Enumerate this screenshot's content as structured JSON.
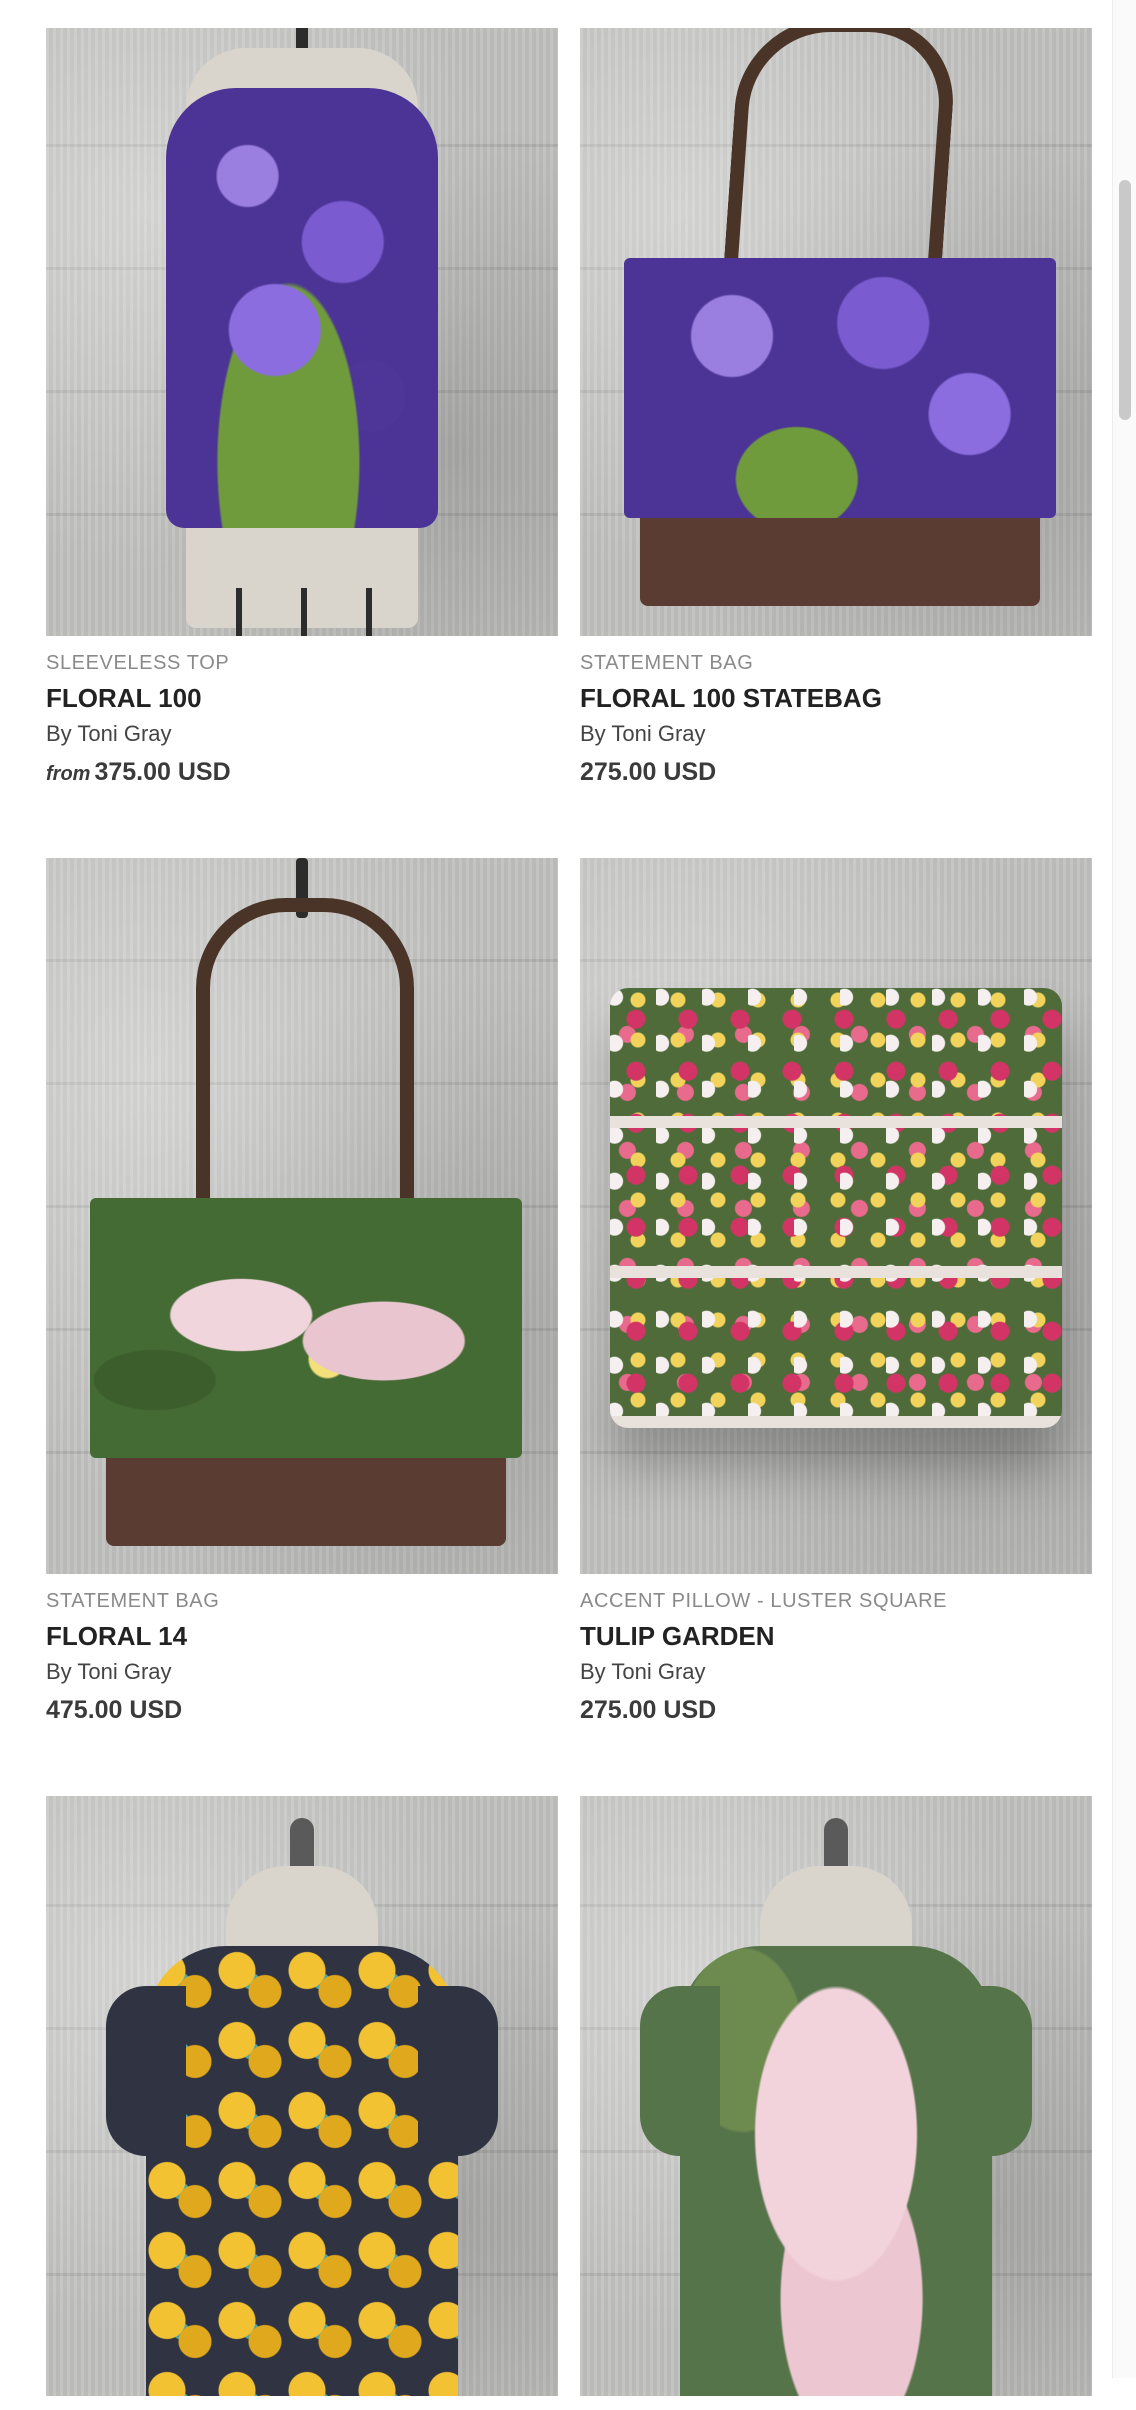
{
  "products": [
    {
      "type": "SLEEVELESS TOP",
      "title": "FLORAL 100",
      "by": "By Toni Gray",
      "price_prefix": "from",
      "price": "375.00 USD",
      "accent": "#5b3fa6"
    },
    {
      "type": "STATEMENT BAG",
      "title": "FLORAL 100 STATEBAG",
      "by": "By Toni Gray",
      "price": "275.00 USD",
      "accent": "#5b3fa6"
    },
    {
      "type": "STATEMENT BAG",
      "title": "FLORAL 14",
      "by": "By Toni Gray",
      "price": "475.00 USD",
      "accent": "#e8c8d0"
    },
    {
      "type": "ACCENT PILLOW - LUSTER SQUARE",
      "title": "TULIP GARDEN",
      "by": "By Toni Gray",
      "price": "275.00 USD",
      "accent": "#c8385a"
    },
    {
      "type": "",
      "title": "",
      "by": "",
      "price": "",
      "accent": "#e3b32a"
    },
    {
      "type": "",
      "title": "",
      "by": "",
      "price": "",
      "accent": "#efc7d4"
    }
  ]
}
